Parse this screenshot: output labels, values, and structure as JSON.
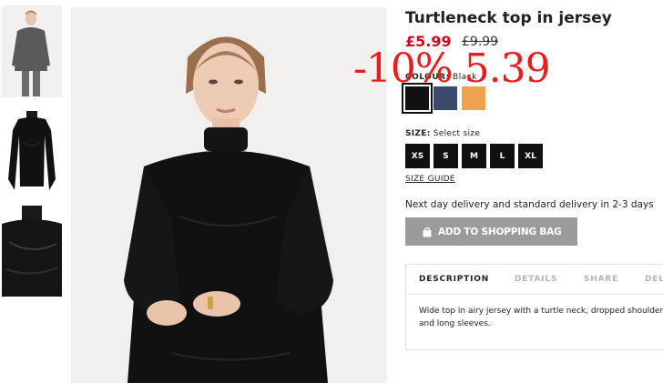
{
  "product": {
    "title": "Turtleneck top in jersey",
    "price_now": "£5.99",
    "price_old": "£9.99",
    "promo_overlay": "-10% 5.39"
  },
  "colour": {
    "label": "COLOUR:",
    "selected": "Black",
    "swatches": [
      {
        "name": "black",
        "hex": "#111111"
      },
      {
        "name": "navy",
        "hex": "#3b4a6b"
      },
      {
        "name": "orange",
        "hex": "#f0a14d"
      }
    ]
  },
  "size": {
    "label": "SIZE:",
    "prompt": "Select size",
    "options": [
      "XS",
      "S",
      "M",
      "L",
      "XL"
    ],
    "guide_label": "SIZE GUIDE"
  },
  "delivery_text": "Next day delivery and standard delivery in 2-3 days",
  "add_to_bag_label": "ADD TO SHOPPING BAG",
  "tabs": {
    "description": "DESCRIPTION",
    "details": "DETAILS",
    "share": "SHARE",
    "delivery": "DELIVERY"
  },
  "description_text": "Wide top in airy jersey with a turtle neck, dropped shoulders and long sleeves.",
  "colors": {
    "sale_red": "#d6001c",
    "promo_red": "#ec1c1c",
    "button_grey": "#9b9b9b"
  }
}
